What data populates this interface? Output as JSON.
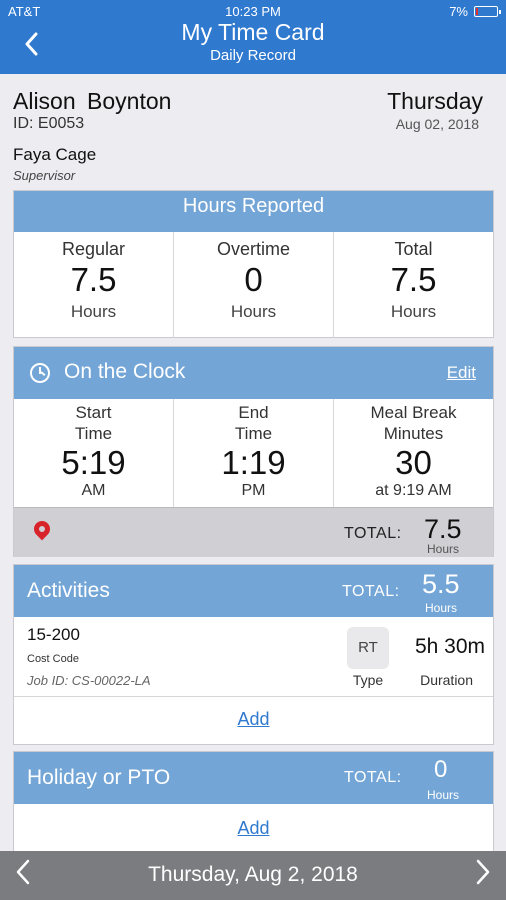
{
  "status_bar": {
    "carrier": "AT&T",
    "time": "10:23 PM",
    "battery": "7%"
  },
  "nav": {
    "title": "My Time Card",
    "subtitle": "Daily Record",
    "back_icon": "chevron-left-icon"
  },
  "employee": {
    "name": "Alison  Boynton",
    "id": "ID: E0053",
    "day": "Thursday",
    "date": "Aug 02, 2018",
    "supervisor_name": "Faya Cage",
    "supervisor_role": "Supervisor"
  },
  "hours_reported": {
    "title": "Hours Reported",
    "columns": [
      {
        "label": "Regular",
        "value": "7.5",
        "unit": "Hours"
      },
      {
        "label": "Overtime",
        "value": "0",
        "unit": "Hours"
      },
      {
        "label": "Total",
        "value": "7.5",
        "unit": "Hours"
      }
    ]
  },
  "on_the_clock": {
    "title": "On the Clock",
    "edit_label": "Edit",
    "start": {
      "line1": "Start",
      "line2": "Time",
      "value": "5:19",
      "sub": "AM"
    },
    "end": {
      "line1": "End",
      "line2": "Time",
      "value": "1:19",
      "sub": "PM"
    },
    "meal": {
      "line1": "Meal Break",
      "line2": "Minutes",
      "value": "30",
      "sub": "at 9:19 AM"
    },
    "total_label": "TOTAL:",
    "total_value": "7.5",
    "total_unit": "Hours"
  },
  "activities": {
    "title": "Activities",
    "total_label": "TOTAL:",
    "total_value": "5.5",
    "total_unit": "Hours",
    "items": [
      {
        "code": "15-200",
        "code_label": "Cost Code",
        "job": "Job ID: CS-00022-LA",
        "type_badge": "RT",
        "type_label": "Type",
        "duration": "5h 30m",
        "duration_label": "Duration"
      }
    ],
    "add_label": "Add"
  },
  "holiday_pto": {
    "title": "Holiday or PTO",
    "total_label": "TOTAL:",
    "total_value": "0",
    "total_unit": "Hours",
    "add_label": "Add"
  },
  "footer": {
    "date": "Thursday, Aug 2, 2018",
    "prev_label": "<",
    "next_label": ">"
  },
  "colors": {
    "primary": "#2f79cf",
    "section_header": "#73a5d6",
    "footer_bg": "#7b7c80",
    "location_pin": "#d8232a"
  }
}
